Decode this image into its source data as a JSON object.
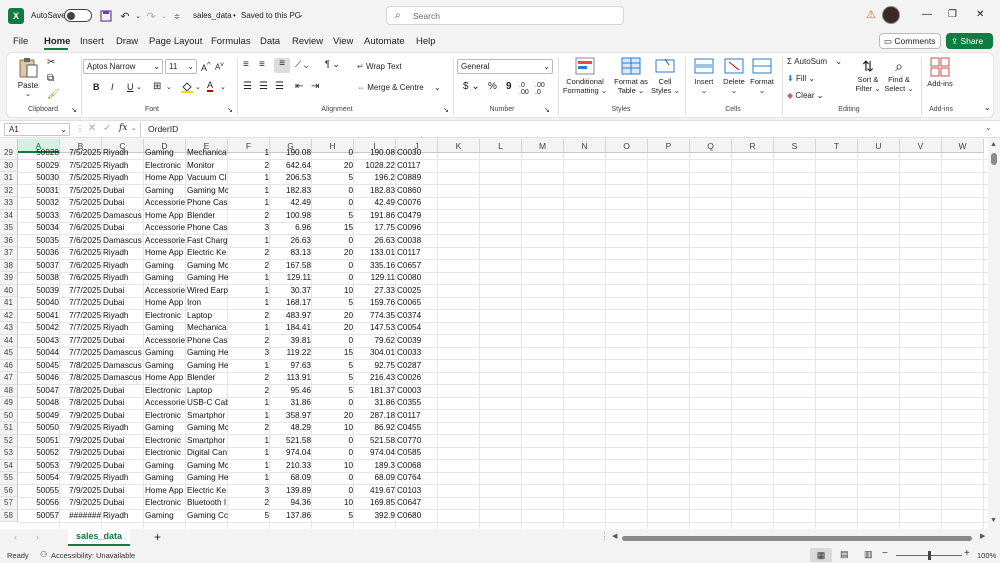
{
  "app": {
    "autosave_label": "AutoSave",
    "autosave_state": "Off",
    "file_title": "sales_data",
    "saved_status": "Saved to this PC",
    "search_placeholder": "Search",
    "minimize": "—",
    "maximize": "❐",
    "close": "✕"
  },
  "menu": [
    "File",
    "Home",
    "Insert",
    "Draw",
    "Page Layout",
    "Formulas",
    "Data",
    "Review",
    "View",
    "Automate",
    "Help"
  ],
  "menu_right": {
    "comments": "Comments",
    "share": "Share"
  },
  "ribbon": {
    "clipboard": {
      "paste": "Paste",
      "label": "Clipboard"
    },
    "font": {
      "name": "Aptos Narrow",
      "size": "11",
      "bold": "B",
      "italic": "I",
      "underline": "U",
      "grow": "A",
      "shrink": "A",
      "label": "Font"
    },
    "alignment": {
      "wrap": "Wrap Text",
      "merge": "Merge & Centre",
      "label": "Alignment"
    },
    "number": {
      "format": "General",
      "currency": "$",
      "percent": "%",
      "comma": "9",
      "label": "Number"
    },
    "styles": {
      "conditional": "Conditional",
      "conditional2": "Formatting",
      "format_as": "Format as",
      "format_as2": "Table",
      "cell_styles": "Cell",
      "cell_styles2": "Styles",
      "label": "Styles"
    },
    "cells": {
      "insert": "Insert",
      "delete": "Delete",
      "format": "Format",
      "label": "Cells"
    },
    "editing": {
      "autosum": "AutoSum",
      "fill": "Fill",
      "clear": "Clear",
      "sort": "Sort &",
      "sort2": "Filter",
      "find": "Find &",
      "find2": "Select",
      "label": "Editing"
    },
    "addins": {
      "addins": "Add-ins",
      "label": "Add-ins"
    }
  },
  "formula": {
    "cell_ref": "A1",
    "fx": "fx",
    "content": "OrderID"
  },
  "columns": [
    "A",
    "B",
    "C",
    "D",
    "E",
    "F",
    "G",
    "H",
    "I",
    "J",
    "K",
    "L",
    "M",
    "N",
    "O",
    "P",
    "Q",
    "R",
    "S",
    "T",
    "U",
    "V",
    "W"
  ],
  "rows": [
    {
      "r": "29",
      "a": "50028",
      "b": "7/5/2025",
      "c": "Riyadh",
      "d": "Gaming",
      "e": "Mechanica",
      "f": "1",
      "g": "190.08",
      "h": "0",
      "i": "190.08",
      "j": "C0030"
    },
    {
      "r": "30",
      "a": "50029",
      "b": "7/5/2025",
      "c": "Riyadh",
      "d": "Electronic",
      "e": "Monitor",
      "f": "2",
      "g": "642.64",
      "h": "20",
      "i": "1028.22",
      "j": "C0117"
    },
    {
      "r": "31",
      "a": "50030",
      "b": "7/5/2025",
      "c": "Riyadh",
      "d": "Home App",
      "e": "Vacuum Cl",
      "f": "1",
      "g": "206.53",
      "h": "5",
      "i": "196.2",
      "j": "C0889"
    },
    {
      "r": "32",
      "a": "50031",
      "b": "7/5/2025",
      "c": "Dubai",
      "d": "Gaming",
      "e": "Gaming Mc",
      "f": "1",
      "g": "182.83",
      "h": "0",
      "i": "182.83",
      "j": "C0860"
    },
    {
      "r": "33",
      "a": "50032",
      "b": "7/5/2025",
      "c": "Dubai",
      "d": "Accessorie",
      "e": "Phone Cas",
      "f": "1",
      "g": "42.49",
      "h": "0",
      "i": "42.49",
      "j": "C0076"
    },
    {
      "r": "34",
      "a": "50033",
      "b": "7/6/2025",
      "c": "Damascus",
      "d": "Home App",
      "e": "Blender",
      "f": "2",
      "g": "100.98",
      "h": "5",
      "i": "191.86",
      "j": "C0479"
    },
    {
      "r": "35",
      "a": "50034",
      "b": "7/6/2025",
      "c": "Dubai",
      "d": "Accessorie",
      "e": "Phone Cas",
      "f": "3",
      "g": "6.96",
      "h": "15",
      "i": "17.75",
      "j": "C0096"
    },
    {
      "r": "36",
      "a": "50035",
      "b": "7/6/2025",
      "c": "Damascus",
      "d": "Accessorie",
      "e": "Fast Charg",
      "f": "1",
      "g": "26.63",
      "h": "0",
      "i": "26.63",
      "j": "C0038"
    },
    {
      "r": "37",
      "a": "50036",
      "b": "7/6/2025",
      "c": "Riyadh",
      "d": "Home App",
      "e": "Electric Ke",
      "f": "2",
      "g": "83.13",
      "h": "20",
      "i": "133.01",
      "j": "C0117"
    },
    {
      "r": "38",
      "a": "50037",
      "b": "7/6/2025",
      "c": "Riyadh",
      "d": "Gaming",
      "e": "Gaming Mc",
      "f": "2",
      "g": "167.58",
      "h": "0",
      "i": "335.16",
      "j": "C0657"
    },
    {
      "r": "39",
      "a": "50038",
      "b": "7/6/2025",
      "c": "Riyadh",
      "d": "Gaming",
      "e": "Gaming He",
      "f": "1",
      "g": "129.11",
      "h": "0",
      "i": "129.11",
      "j": "C0080"
    },
    {
      "r": "40",
      "a": "50039",
      "b": "7/7/2025",
      "c": "Dubai",
      "d": "Accessorie",
      "e": "Wired Earp",
      "f": "1",
      "g": "30.37",
      "h": "10",
      "i": "27.33",
      "j": "C0025"
    },
    {
      "r": "41",
      "a": "50040",
      "b": "7/7/2025",
      "c": "Dubai",
      "d": "Home App",
      "e": "Iron",
      "f": "1",
      "g": "168.17",
      "h": "5",
      "i": "159.76",
      "j": "C0065"
    },
    {
      "r": "42",
      "a": "50041",
      "b": "7/7/2025",
      "c": "Riyadh",
      "d": "Electronic",
      "e": "Laptop",
      "f": "2",
      "g": "483.97",
      "h": "20",
      "i": "774.35",
      "j": "C0374"
    },
    {
      "r": "43",
      "a": "50042",
      "b": "7/7/2025",
      "c": "Riyadh",
      "d": "Gaming",
      "e": "Mechanica",
      "f": "1",
      "g": "184.41",
      "h": "20",
      "i": "147.53",
      "j": "C0054"
    },
    {
      "r": "44",
      "a": "50043",
      "b": "7/7/2025",
      "c": "Dubai",
      "d": "Accessorie",
      "e": "Phone Cas",
      "f": "2",
      "g": "39.81",
      "h": "0",
      "i": "79.62",
      "j": "C0039"
    },
    {
      "r": "45",
      "a": "50044",
      "b": "7/7/2025",
      "c": "Damascus",
      "d": "Gaming",
      "e": "Gaming He",
      "f": "3",
      "g": "119.22",
      "h": "15",
      "i": "304.01",
      "j": "C0033"
    },
    {
      "r": "46",
      "a": "50045",
      "b": "7/8/2025",
      "c": "Damascus",
      "d": "Gaming",
      "e": "Gaming He",
      "f": "1",
      "g": "97.63",
      "h": "5",
      "i": "92.75",
      "j": "C0287"
    },
    {
      "r": "47",
      "a": "50046",
      "b": "7/8/2025",
      "c": "Damascus",
      "d": "Home App",
      "e": "Blender",
      "f": "2",
      "g": "113.91",
      "h": "5",
      "i": "216.43",
      "j": "C0026"
    },
    {
      "r": "48",
      "a": "50047",
      "b": "7/8/2025",
      "c": "Dubai",
      "d": "Electronic",
      "e": "Laptop",
      "f": "2",
      "g": "95.46",
      "h": "5",
      "i": "181.37",
      "j": "C0003"
    },
    {
      "r": "49",
      "a": "50048",
      "b": "7/8/2025",
      "c": "Dubai",
      "d": "Accessorie",
      "e": "USB-C Cab",
      "f": "1",
      "g": "31.86",
      "h": "0",
      "i": "31.86",
      "j": "C0355"
    },
    {
      "r": "50",
      "a": "50049",
      "b": "7/9/2025",
      "c": "Dubai",
      "d": "Electronic",
      "e": "Smartphor",
      "f": "1",
      "g": "358.97",
      "h": "20",
      "i": "287.18",
      "j": "C0117"
    },
    {
      "r": "51",
      "a": "50050",
      "b": "7/9/2025",
      "c": "Riyadh",
      "d": "Gaming",
      "e": "Gaming Mc",
      "f": "2",
      "g": "48.29",
      "h": "10",
      "i": "86.92",
      "j": "C0455"
    },
    {
      "r": "52",
      "a": "50051",
      "b": "7/9/2025",
      "c": "Dubai",
      "d": "Electronic",
      "e": "Smartphor",
      "f": "1",
      "g": "521.58",
      "h": "0",
      "i": "521.58",
      "j": "C0770"
    },
    {
      "r": "53",
      "a": "50052",
      "b": "7/9/2025",
      "c": "Dubai",
      "d": "Electronic",
      "e": "Digital Can",
      "f": "1",
      "g": "974.04",
      "h": "0",
      "i": "974.04",
      "j": "C0585"
    },
    {
      "r": "54",
      "a": "50053",
      "b": "7/9/2025",
      "c": "Dubai",
      "d": "Gaming",
      "e": "Gaming Mc",
      "f": "1",
      "g": "210.33",
      "h": "10",
      "i": "189.3",
      "j": "C0068"
    },
    {
      "r": "55",
      "a": "50054",
      "b": "7/9/2025",
      "c": "Riyadh",
      "d": "Gaming",
      "e": "Gaming He",
      "f": "1",
      "g": "68.09",
      "h": "0",
      "i": "68.09",
      "j": "C0764"
    },
    {
      "r": "56",
      "a": "50055",
      "b": "7/9/2025",
      "c": "Dubai",
      "d": "Home App",
      "e": "Electric Ke",
      "f": "3",
      "g": "139.89",
      "h": "0",
      "i": "419.67",
      "j": "C0103"
    },
    {
      "r": "57",
      "a": "50056",
      "b": "7/9/2025",
      "c": "Dubai",
      "d": "Electronic",
      "e": "Bluetooth I",
      "f": "2",
      "g": "94.36",
      "h": "10",
      "i": "169.85",
      "j": "C0647"
    },
    {
      "r": "58",
      "a": "50057",
      "b": "#######",
      "c": "Riyadh",
      "d": "Gaming",
      "e": "Gaming Cc",
      "f": "5",
      "g": "137.86",
      "h": "5",
      "i": "392.9",
      "j": "C0680"
    }
  ],
  "sheets": {
    "active": "sales_data",
    "add": "+"
  },
  "status": {
    "ready": "Ready",
    "accessibility": "Accessibility: Unavailable",
    "zoom": "100%"
  },
  "colors": {
    "excel_green": "#107c41",
    "share_green": "#107c41",
    "selection": "#e6f2ea"
  }
}
